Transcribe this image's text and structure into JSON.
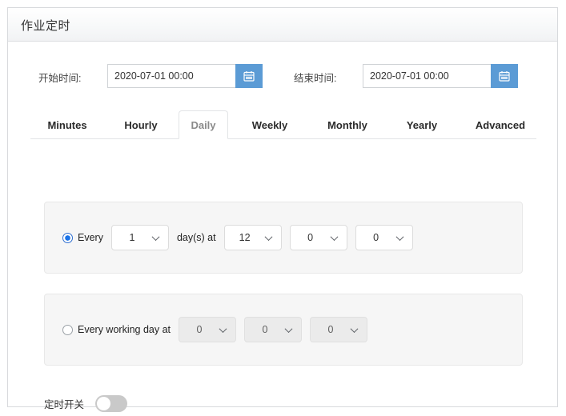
{
  "window": {
    "title": "作业定时"
  },
  "datetime": {
    "start": {
      "label": "开始时间:",
      "value": "2020-07-01 00:00",
      "placeholder": "2020-07-01 00:00",
      "button_icon": "calendar-icon"
    },
    "end": {
      "label": "结束时间:",
      "value": "2020-07-01 00:00",
      "placeholder": "2020-07-01 00:00",
      "button_icon": "calendar-icon"
    },
    "accent_color": "#5b9bd5"
  },
  "tabs": {
    "active": "Daily",
    "items": [
      {
        "label": "Minutes"
      },
      {
        "label": "Hourly"
      },
      {
        "label": "Daily"
      },
      {
        "label": "Weekly"
      },
      {
        "label": "Monthly"
      },
      {
        "label": "Yearly"
      },
      {
        "label": "Advanced"
      }
    ]
  },
  "schedule": {
    "every_n_days": {
      "selected": true,
      "prefix_label": "Every",
      "middle_label": "day(s) at",
      "days": {
        "value": "1"
      },
      "hour": {
        "value": "12"
      },
      "minute": {
        "value": "0"
      },
      "second": {
        "value": "0"
      }
    },
    "every_working_day": {
      "selected": false,
      "label": "Every working day at",
      "disabled": true,
      "hour": {
        "value": "0"
      },
      "minute": {
        "value": "0"
      },
      "second": {
        "value": "0"
      }
    }
  },
  "timer_switch": {
    "label": "定时开关",
    "on": false
  }
}
